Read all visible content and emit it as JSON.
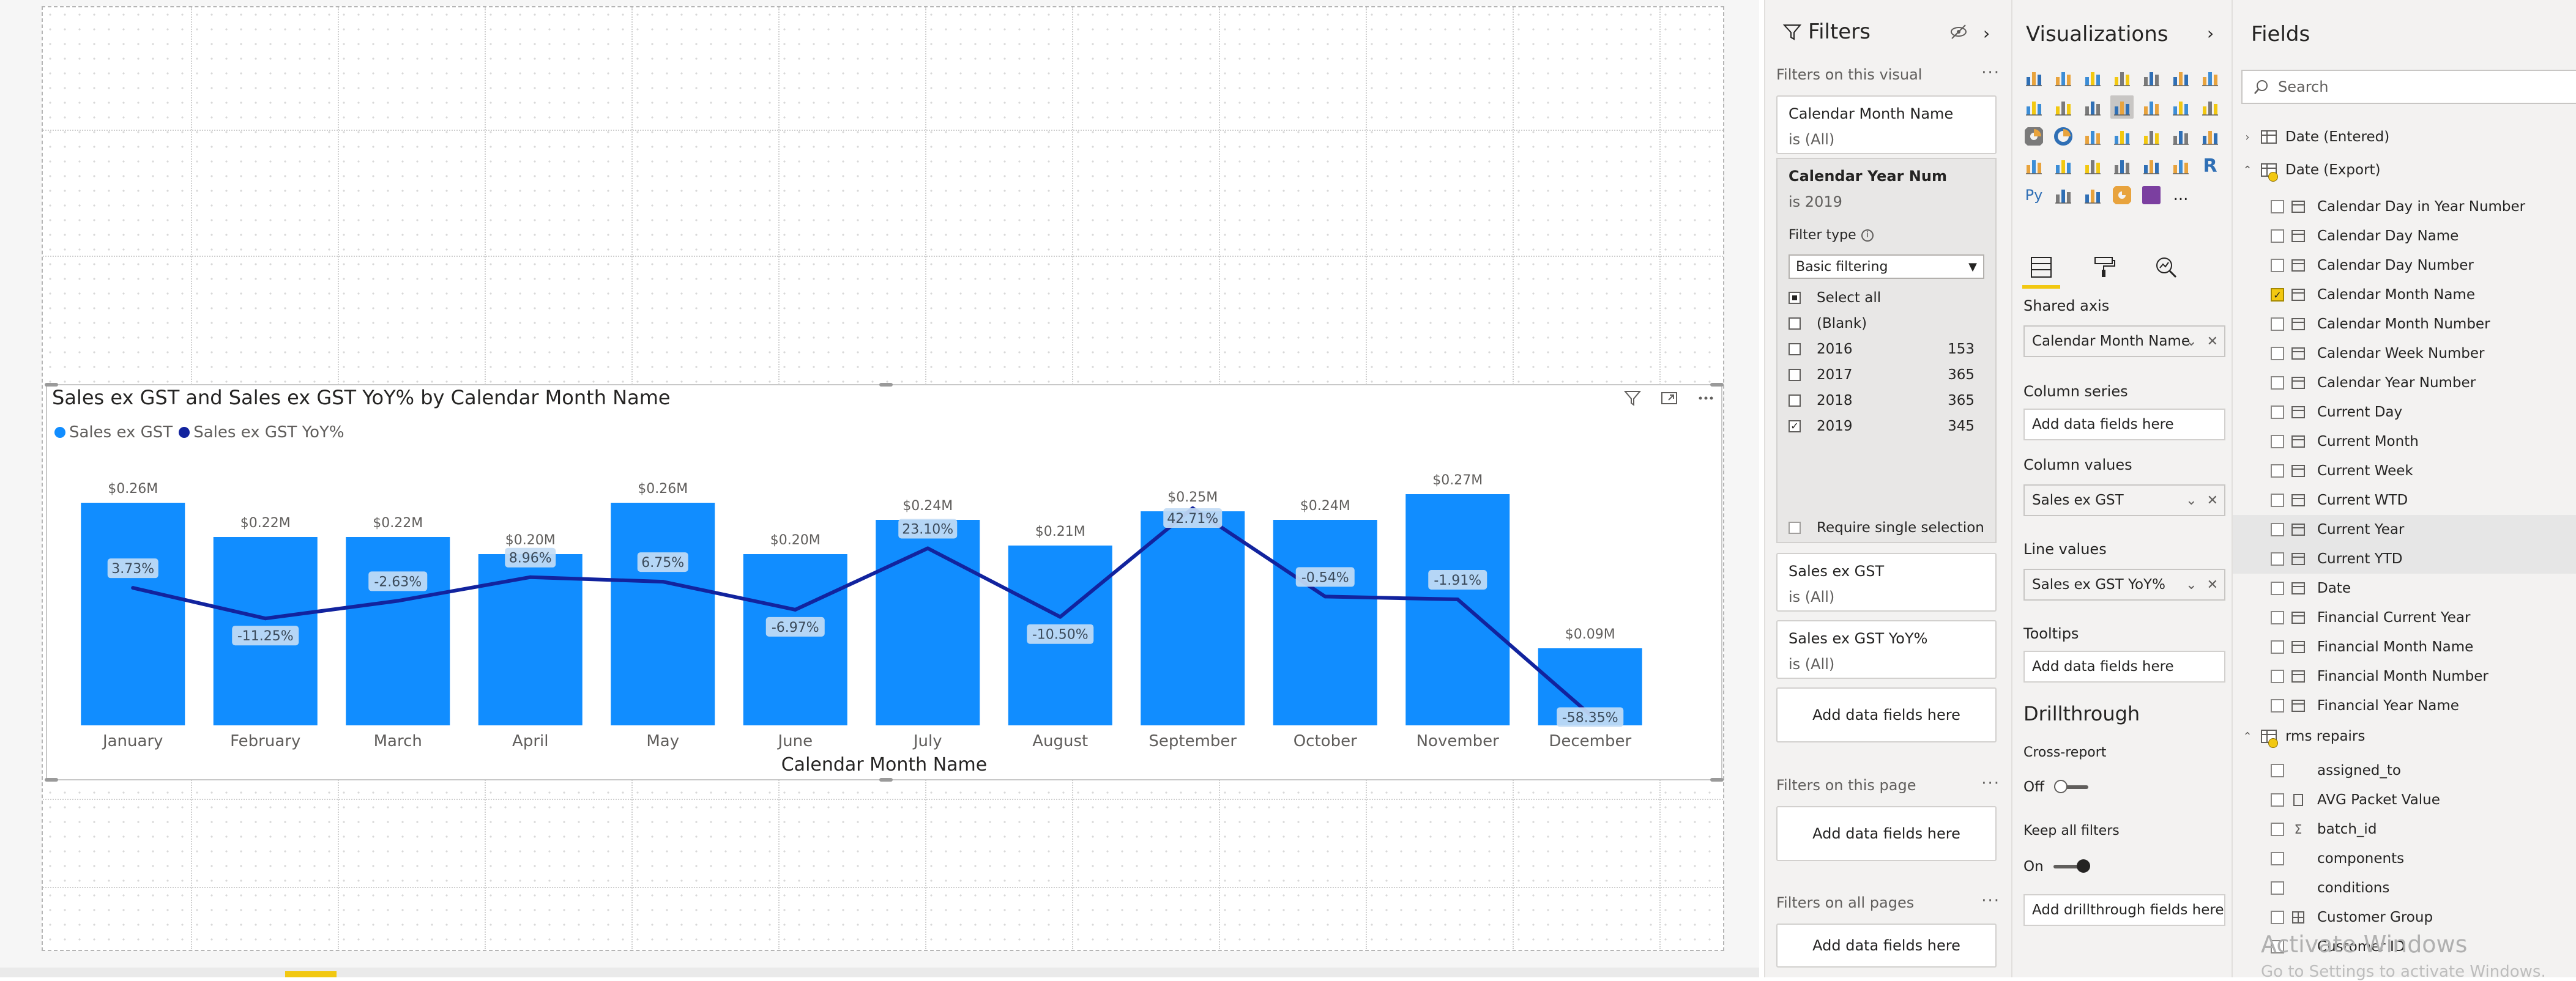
{
  "visual": {
    "title": "Sales ex GST and Sales ex GST YoY% by Calendar Month Name",
    "legend": [
      {
        "label": "Sales ex GST",
        "color": "#118dff"
      },
      {
        "label": "Sales ex GST YoY%",
        "color": "#12239e"
      }
    ],
    "header_icons": [
      "filter-icon",
      "focus-mode-icon",
      "more-options-icon"
    ]
  },
  "chart_data": {
    "type": "bar",
    "combo": "bar+line",
    "title": "Sales ex GST and Sales ex GST YoY% by Calendar Month Name",
    "xlabel": "Calendar Month Name",
    "ylabel": "",
    "categories": [
      "January",
      "February",
      "March",
      "April",
      "May",
      "June",
      "July",
      "August",
      "September",
      "October",
      "November",
      "December"
    ],
    "series": [
      {
        "name": "Sales ex GST",
        "type": "bar",
        "color": "#118dff",
        "values": [
          0.26,
          0.22,
          0.22,
          0.2,
          0.26,
          0.2,
          0.24,
          0.21,
          0.25,
          0.24,
          0.27,
          0.09
        ],
        "labels": [
          "$0.26M",
          "$0.22M",
          "$0.22M",
          "$0.20M",
          "$0.26M",
          "$0.20M",
          "$0.24M",
          "$0.21M",
          "$0.25M",
          "$0.24M",
          "$0.27M",
          "$0.09M"
        ]
      },
      {
        "name": "Sales ex GST YoY%",
        "type": "line",
        "color": "#12239e",
        "values": [
          3.73,
          -11.25,
          -2.63,
          8.96,
          6.75,
          -6.97,
          23.1,
          -10.5,
          42.71,
          -0.54,
          -1.91,
          -58.35
        ],
        "labels": [
          "3.73%",
          "-11.25%",
          "-2.63%",
          "8.96%",
          "6.75%",
          "-6.97%",
          "23.10%",
          "-10.50%",
          "42.71%",
          "-0.54%",
          "-1.91%",
          "-58.35%"
        ]
      }
    ],
    "legend_position": "top-left",
    "grid": false
  },
  "filters": {
    "title": "Filters",
    "on_visual_label": "Filters on this visual",
    "calendar_month": {
      "name": "Calendar Month Name",
      "sub": "is (All)"
    },
    "calendar_year": {
      "name": "Calendar Year Num",
      "sub": "is 2019",
      "filter_type_label": "Filter type",
      "filter_type_value": "Basic filtering",
      "items": [
        {
          "label": "Select all",
          "count": "",
          "state": "partial"
        },
        {
          "label": "(Blank)",
          "count": "",
          "state": "unchecked"
        },
        {
          "label": "2016",
          "count": "153",
          "state": "unchecked"
        },
        {
          "label": "2017",
          "count": "365",
          "state": "unchecked"
        },
        {
          "label": "2018",
          "count": "365",
          "state": "unchecked"
        },
        {
          "label": "2019",
          "count": "345",
          "state": "checked"
        }
      ],
      "require_single": "Require single selection"
    },
    "sales": {
      "name": "Sales ex GST",
      "sub": "is (All)"
    },
    "sales_yoy": {
      "name": "Sales ex GST YoY%",
      "sub": "is (All)"
    },
    "add_fields": "Add data fields here",
    "on_page_label": "Filters on this page",
    "on_all_pages_label": "Filters on all pages"
  },
  "visualizations": {
    "title": "Visualizations",
    "shared_axis_label": "Shared axis",
    "shared_axis_value": "Calendar Month Name",
    "column_series_label": "Column series",
    "column_values_label": "Column values",
    "column_values_value": "Sales ex GST",
    "line_values_label": "Line values",
    "line_values_value": "Sales ex GST YoY%",
    "tooltips_label": "Tooltips",
    "add_fields": "Add data fields here",
    "drillthrough_title": "Drillthrough",
    "cross_report_label": "Cross-report",
    "cross_report_value": "Off",
    "keep_filters_label": "Keep all filters",
    "keep_filters_value": "On",
    "add_drillthrough": "Add drillthrough fields here",
    "r_label": "R",
    "py_label": "Py",
    "more_dots": "..."
  },
  "fields": {
    "title": "Fields",
    "search_placeholder": "Search",
    "tables": [
      {
        "name": "Date (Entered)",
        "expanded": false,
        "checked_mark": false
      },
      {
        "name": "Date (Export)",
        "expanded": true,
        "checked_mark": true
      }
    ],
    "date_export_fields": [
      {
        "label": "Calendar Day in Year Number",
        "checked": false,
        "icon": "calendar-field-icon"
      },
      {
        "label": "Calendar Day Name",
        "checked": false,
        "icon": "calendar-field-icon"
      },
      {
        "label": "Calendar Day Number",
        "checked": false,
        "icon": "calendar-field-icon"
      },
      {
        "label": "Calendar Month Name",
        "checked": true,
        "icon": "calendar-field-icon"
      },
      {
        "label": "Calendar Month Number",
        "checked": false,
        "icon": "calendar-field-icon"
      },
      {
        "label": "Calendar Week Number",
        "checked": false,
        "icon": "calendar-field-icon"
      },
      {
        "label": "Calendar Year Number",
        "checked": false,
        "icon": "calendar-field-icon"
      },
      {
        "label": "Current Day",
        "checked": false,
        "icon": "calendar-field-icon"
      },
      {
        "label": "Current Month",
        "checked": false,
        "icon": "calendar-field-icon"
      },
      {
        "label": "Current Week",
        "checked": false,
        "icon": "calendar-field-icon"
      },
      {
        "label": "Current WTD",
        "checked": false,
        "icon": "calendar-field-icon"
      },
      {
        "label": "Current Year",
        "checked": false,
        "icon": "calendar-field-icon"
      },
      {
        "label": "Current YTD",
        "checked": false,
        "icon": "calendar-field-icon"
      },
      {
        "label": "Date",
        "checked": false,
        "icon": "date-hierarchy-icon"
      },
      {
        "label": "Financial Current Year",
        "checked": false,
        "icon": "calendar-field-icon"
      },
      {
        "label": "Financial Month Name",
        "checked": false,
        "icon": "calendar-field-icon"
      },
      {
        "label": "Financial Month Number",
        "checked": false,
        "icon": "calendar-field-icon"
      },
      {
        "label": "Financial Year Name",
        "checked": false,
        "icon": "calendar-field-icon"
      }
    ],
    "rms_table": {
      "name": "rms repairs",
      "expanded": true
    },
    "rms_fields": [
      {
        "label": "assigned_to",
        "icon": "none"
      },
      {
        "label": "AVG Packet Value",
        "icon": "measure-icon"
      },
      {
        "label": "batch_id",
        "icon": "sum-icon"
      },
      {
        "label": "components",
        "icon": "none"
      },
      {
        "label": "conditions",
        "icon": "none"
      },
      {
        "label": "Customer Group",
        "icon": "group-icon"
      },
      {
        "label": "Customer ID",
        "icon": "none"
      }
    ]
  },
  "watermark": {
    "line1": "Activate Windows",
    "line2": "Go to Settings to activate Windows."
  }
}
